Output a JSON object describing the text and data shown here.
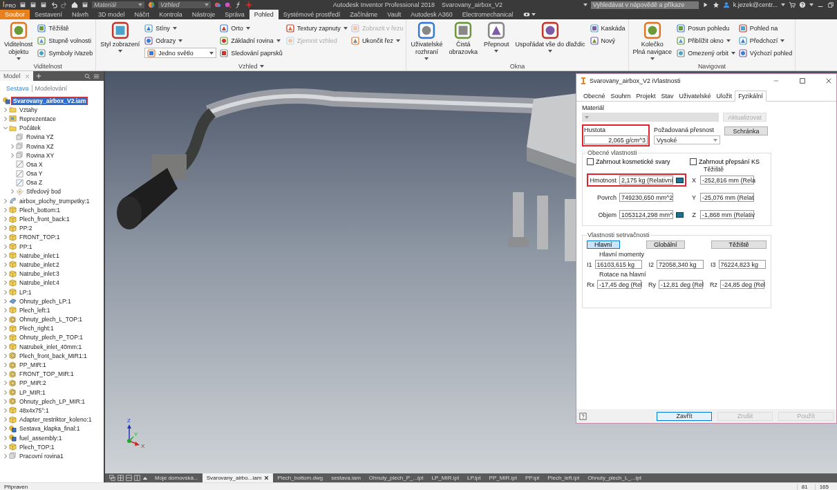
{
  "titlebar": {
    "logo": "I",
    "logo_edition": "PRO",
    "material_placeholder": "Materiál",
    "appearance_placeholder": "Vzhled",
    "title": "Autodesk Inventor Professional 2018",
    "document": "Svarovany_airbox_V2",
    "search_placeholder": "Vyhledávat v nápovědě a příkaze",
    "user": "k.jezek@centr..."
  },
  "menu_tabs": [
    {
      "label": "Soubor",
      "kind": "file",
      "selected": false
    },
    {
      "label": "Sestavení",
      "kind": "tab",
      "selected": false
    },
    {
      "label": "Návrh",
      "kind": "tab",
      "selected": false
    },
    {
      "label": "3D model",
      "kind": "tab",
      "selected": false
    },
    {
      "label": "Náčrt",
      "kind": "tab",
      "selected": false
    },
    {
      "label": "Kontrola",
      "kind": "tab",
      "selected": false
    },
    {
      "label": "Nástroje",
      "kind": "tab",
      "selected": false
    },
    {
      "label": "Správa",
      "kind": "tab",
      "selected": false
    },
    {
      "label": "Pohled",
      "kind": "tab",
      "selected": true
    },
    {
      "label": "Systémové prostředí",
      "kind": "tab",
      "selected": false
    },
    {
      "label": "Začínáme",
      "kind": "tab",
      "selected": false
    },
    {
      "label": "Vault",
      "kind": "tab",
      "selected": false
    },
    {
      "label": "Autodesk A360",
      "kind": "tab",
      "selected": false
    },
    {
      "label": "Electromechanical",
      "kind": "tab",
      "selected": false
    }
  ],
  "ribbon": [
    {
      "title": "Viditelnost",
      "dropdown": false,
      "columns": [
        {
          "kind": "large",
          "items": [
            {
              "label": "Viditelnost\nobjektu",
              "dropdown": true,
              "disabled": false
            }
          ]
        },
        {
          "kind": "small",
          "items": [
            {
              "label": "Těžiště",
              "dropdown": false,
              "disabled": false
            },
            {
              "label": "Stupně volnosti",
              "dropdown": false,
              "disabled": false
            },
            {
              "label": "Symboly iVazeb",
              "dropdown": false,
              "disabled": false
            }
          ]
        }
      ]
    },
    {
      "title": "Vzhled",
      "dropdown": true,
      "columns": [
        {
          "kind": "large",
          "items": [
            {
              "label": "Styl zobrazení",
              "dropdown": true,
              "disabled": false
            }
          ]
        },
        {
          "kind": "small",
          "items": [
            {
              "label": "Stíny",
              "dropdown": true,
              "disabled": false
            },
            {
              "label": "Odrazy",
              "dropdown": true,
              "disabled": false
            },
            {
              "label": "Jedno světlo",
              "kind": "combo",
              "dropdown": true,
              "disabled": false
            }
          ]
        },
        {
          "kind": "small",
          "items": [
            {
              "label": "Orto",
              "dropdown": true,
              "disabled": false
            },
            {
              "label": "Základní rovina",
              "dropdown": true,
              "disabled": false
            },
            {
              "label": "Sledování paprsků",
              "dropdown": false,
              "disabled": false
            }
          ]
        },
        {
          "kind": "small",
          "items": [
            {
              "label": "Textury zapnuty",
              "dropdown": true,
              "disabled": false
            },
            {
              "label": "Zjemnit vzhled",
              "dropdown": false,
              "disabled": true
            }
          ]
        },
        {
          "kind": "small",
          "items": [
            {
              "label": "Zobrazit v řezu",
              "dropdown": false,
              "disabled": true
            },
            {
              "label": "Ukončit řez",
              "dropdown": true,
              "disabled": false
            }
          ]
        }
      ]
    },
    {
      "title": "Okna",
      "dropdown": false,
      "columns": [
        {
          "kind": "large",
          "items": [
            {
              "label": "Uživatelské\nrozhraní",
              "dropdown": true,
              "disabled": false
            }
          ]
        },
        {
          "kind": "large",
          "items": [
            {
              "label": "Čistá\nobrazovka",
              "dropdown": false,
              "disabled": false
            }
          ]
        },
        {
          "kind": "large",
          "items": [
            {
              "label": "Přepnout",
              "dropdown": true,
              "disabled": false
            }
          ]
        },
        {
          "kind": "large",
          "items": [
            {
              "label": "Uspořádat vše do dlaždic",
              "dropdown": true,
              "disabled": false
            }
          ]
        },
        {
          "kind": "small",
          "items": [
            {
              "label": "Kaskáda",
              "dropdown": false,
              "disabled": false
            },
            {
              "label": "Nový",
              "dropdown": false,
              "disabled": false
            }
          ]
        }
      ]
    },
    {
      "title": "Navigovat",
      "dropdown": false,
      "columns": [
        {
          "kind": "large",
          "items": [
            {
              "label": "Kolečko\nPlná navigace",
              "dropdown": true,
              "disabled": false
            }
          ]
        },
        {
          "kind": "small",
          "items": [
            {
              "label": "Posun pohledu",
              "dropdown": false,
              "disabled": false
            },
            {
              "label": "Přiblížit okno",
              "dropdown": true,
              "disabled": false
            },
            {
              "label": "Omezený orbit",
              "dropdown": true,
              "disabled": false
            }
          ]
        },
        {
          "kind": "small",
          "items": [
            {
              "label": "Pohled na",
              "dropdown": false,
              "disabled": false
            },
            {
              "label": "Předchozí",
              "dropdown": true,
              "disabled": false
            },
            {
              "label": "Výchozí pohled",
              "dropdown": false,
              "disabled": false
            }
          ]
        }
      ]
    }
  ],
  "browser": {
    "tab": "Model",
    "modes": [
      {
        "label": "Sestava",
        "selected": true
      },
      {
        "label": "Modelování",
        "selected": false
      }
    ],
    "tree": {
      "label": "Svarovany_airbox_V2.iam",
      "kind": "assembly",
      "selected": true,
      "children": [
        {
          "label": "Vztahy",
          "kind": "folder",
          "selected": false,
          "expanded": false
        },
        {
          "label": "Reprezentace",
          "kind": "repr",
          "selected": false,
          "expanded": false
        },
        {
          "label": "Počátek",
          "kind": "folder",
          "selected": false,
          "expanded": true,
          "children": [
            {
              "label": "Rovina YZ",
              "kind": "plane",
              "selected": false
            },
            {
              "label": "Rovina XZ",
              "kind": "plane",
              "selected": false,
              "expanded": false
            },
            {
              "label": "Rovina XY",
              "kind": "plane",
              "selected": false,
              "expanded": false
            },
            {
              "label": "Osa X",
              "kind": "axis",
              "selected": false
            },
            {
              "label": "Osa Y",
              "kind": "axis",
              "selected": false
            },
            {
              "label": "Osa Z",
              "kind": "axis",
              "selected": false
            },
            {
              "label": "Středový bod",
              "kind": "point",
              "selected": false,
              "expanded": false
            }
          ]
        },
        {
          "label": "airbox_plochy_trumpetky:1",
          "kind": "surface",
          "selected": false,
          "expanded": false
        },
        {
          "label": "Plech_bottom:1",
          "kind": "part",
          "selected": false,
          "expanded": false
        },
        {
          "label": "Plech_front_back:1",
          "kind": "part",
          "selected": false,
          "expanded": false
        },
        {
          "label": "PP:2",
          "kind": "part",
          "selected": false,
          "expanded": false
        },
        {
          "label": "FRONT_TOP:1",
          "kind": "part",
          "selected": false,
          "expanded": false
        },
        {
          "label": "PP:1",
          "kind": "part",
          "selected": false,
          "expanded": false
        },
        {
          "label": "Natrube_inlet:1",
          "kind": "part",
          "selected": false,
          "expanded": false
        },
        {
          "label": "Natrube_inlet:2",
          "kind": "part",
          "selected": false,
          "expanded": false
        },
        {
          "label": "Natrube_inlet:3",
          "kind": "part",
          "selected": false,
          "expanded": false
        },
        {
          "label": "Natrube_inlet:4",
          "kind": "part",
          "selected": false,
          "expanded": false
        },
        {
          "label": "LP:1",
          "kind": "part",
          "selected": false,
          "expanded": false
        },
        {
          "label": "Ohnuty_plech_LP:1",
          "kind": "sheet",
          "selected": false,
          "expanded": false
        },
        {
          "label": "Plech_left:1",
          "kind": "part",
          "selected": false,
          "expanded": false
        },
        {
          "label": "Ohnuty_plech_L_TOP:1",
          "kind": "mirror",
          "selected": false,
          "expanded": false
        },
        {
          "label": "Plech_right:1",
          "kind": "part",
          "selected": false,
          "expanded": false
        },
        {
          "label": "Ohnuty_plech_P_TOP:1",
          "kind": "part",
          "selected": false,
          "expanded": false
        },
        {
          "label": "Natrubek_inlet_40mm:1",
          "kind": "part",
          "selected": false,
          "expanded": false
        },
        {
          "label": "Plech_front_back_MIR1:1",
          "kind": "mirror",
          "selected": false,
          "expanded": false
        },
        {
          "label": "PP_MIR:1",
          "kind": "mirror",
          "selected": false,
          "expanded": false
        },
        {
          "label": "FRONT_TOP_MIR:1",
          "kind": "mirror",
          "selected": false,
          "expanded": false
        },
        {
          "label": "PP_MIR:2",
          "kind": "mirror",
          "selected": false,
          "expanded": false
        },
        {
          "label": "LP_MIR:1",
          "kind": "mirror",
          "selected": false,
          "expanded": false
        },
        {
          "label": "Ohnuty_plech_LP_MIR:1",
          "kind": "mirror",
          "selected": false,
          "expanded": false
        },
        {
          "label": "48x4x75°:1",
          "kind": "part",
          "selected": false,
          "expanded": false
        },
        {
          "label": "Adapter_restriktor_koleno:1",
          "kind": "part",
          "selected": false,
          "expanded": false
        },
        {
          "label": "Sestava_klapka_final:1",
          "kind": "assembly",
          "selected": false,
          "expanded": false
        },
        {
          "label": "fuel_assembly:1",
          "kind": "assembly",
          "selected": false,
          "expanded": false
        },
        {
          "label": "Plech_TOP:1",
          "kind": "part",
          "selected": false,
          "expanded": false
        },
        {
          "label": "Pracovní rovina1",
          "kind": "plane",
          "selected": false,
          "expanded": false
        }
      ]
    }
  },
  "viewport": {
    "axis_labels": [
      "Z",
      "Y",
      "X"
    ]
  },
  "dialog": {
    "title": "Svarovany_airbox_V2 iVlastnosti",
    "tabs": [
      {
        "label": "Obecné",
        "selected": false
      },
      {
        "label": "Souhrn",
        "selected": false
      },
      {
        "label": "Projekt",
        "selected": false
      },
      {
        "label": "Stav",
        "selected": false
      },
      {
        "label": "Uživatelské",
        "selected": false
      },
      {
        "label": "Uložit",
        "selected": false
      },
      {
        "label": "Fyzikální",
        "selected": true
      }
    ],
    "material": {
      "label": "Materiál",
      "disabled": true
    },
    "update_button": {
      "label": "Aktualizovat",
      "disabled": true
    },
    "density": {
      "label": "Hustota",
      "value": "2,065 g/cm^3",
      "highlighted": true
    },
    "accuracy": {
      "label": "Požadovaná přesnost",
      "value": "Vysoké"
    },
    "clipboard_button": {
      "label": "Schránka",
      "disabled": false
    },
    "general": {
      "title": "Obecné vlastnosti",
      "options": [
        {
          "label": "Zahrnout kosmetické svary",
          "checked": false
        },
        {
          "label": "Zahrnout přepsání KS",
          "checked": false
        }
      ],
      "center_title": "Těžiště",
      "rows": [
        {
          "label": "Hmotnost",
          "value": "2,175 kg (Relativní",
          "highlighted": true,
          "has_button": true,
          "axis": "X",
          "axis_value": "-252,816 mm (Rela"
        },
        {
          "label": "Povrch",
          "value": "749230,650 mm^2",
          "highlighted": false,
          "has_button": false,
          "axis": "Y",
          "axis_value": "-25,076 mm (Relat"
        },
        {
          "label": "Objem",
          "value": "1053124,298 mm^",
          "highlighted": false,
          "has_button": true,
          "axis": "Z",
          "axis_value": "-1,868 mm (Relativ"
        }
      ]
    },
    "inertia": {
      "title": "Vlastnosti setrvačnosti",
      "modes": [
        {
          "label": "Hlavní",
          "selected": true
        },
        {
          "label": "Globální",
          "selected": false
        },
        {
          "label": "Těžiště",
          "selected": false
        }
      ],
      "moments_title": "Hlavní momenty",
      "moments": [
        {
          "label": "I1",
          "value": "16103,615 kg"
        },
        {
          "label": "I2",
          "value": "72058,340 kg"
        },
        {
          "label": "I3",
          "value": "76224,823 kg"
        }
      ],
      "rotation_title": "Rotace na hlavní",
      "rotations": [
        {
          "label": "Rx",
          "value": "-17,45 deg (Rel"
        },
        {
          "label": "Ry",
          "value": "-12,81 deg (Rel"
        },
        {
          "label": "Rz",
          "value": "-24,85 deg (Rel"
        }
      ]
    },
    "buttons": [
      {
        "label": "Zavřít",
        "default": true,
        "disabled": false
      },
      {
        "label": "Zrušit",
        "default": false,
        "disabled": true
      },
      {
        "label": "Použít",
        "default": false,
        "disabled": true
      }
    ]
  },
  "document_tabs": [
    {
      "label": "Moje domovská...",
      "selected": false
    },
    {
      "label": "Svarovany_airbo...iam",
      "selected": true
    },
    {
      "label": "Plech_bottom.dwg",
      "selected": false
    },
    {
      "label": "sestava.iam",
      "selected": false
    },
    {
      "label": "Ohnuty_plech_P_...ipt",
      "selected": false
    },
    {
      "label": "LP_MIR.ipt",
      "selected": false
    },
    {
      "label": "LP.ipt",
      "selected": false
    },
    {
      "label": "PP_MIR.ipt",
      "selected": false
    },
    {
      "label": "PP.ipt",
      "selected": false
    },
    {
      "label": "Plech_left.ipt",
      "selected": false
    },
    {
      "label": "Ohnuty_plech_L_...ipt",
      "selected": false
    }
  ],
  "status_bar": {
    "message": "Připraven",
    "readouts": [
      "81",
      "165"
    ]
  }
}
